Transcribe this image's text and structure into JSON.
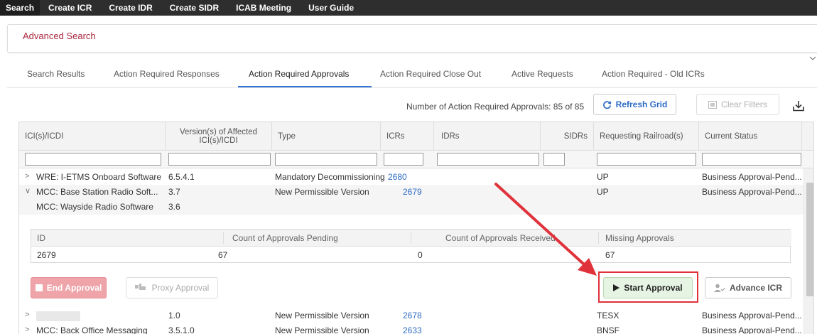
{
  "topnav": {
    "items": [
      "Search",
      "Create ICR",
      "Create IDR",
      "Create SIDR",
      "ICAB Meeting",
      "User Guide"
    ]
  },
  "advanced_search": {
    "title": "Advanced Search"
  },
  "tabs": [
    "Search Results",
    "Action Required Responses",
    "Action Required Approvals",
    "Action Required Close Out",
    "Active Requests",
    "Action Required - Old ICRs"
  ],
  "active_tab": "Action Required Approvals",
  "toolbar": {
    "count_text": "Number of Action Required Approvals: 85 of 85",
    "refresh_label": "Refresh Grid",
    "clear_label": "Clear Filters"
  },
  "grid": {
    "headers": [
      "ICI(s)/ICDI",
      "Version(s) of Affected ICI(s)/ICDI",
      "Type",
      "ICRs",
      "IDRs",
      "SIDRs",
      "Requesting Railroad(s)",
      "Current Status"
    ],
    "rows": [
      {
        "ici": "WRE: I-ETMS Onboard Software",
        "version": "6.5.4.1",
        "type": "Mandatory Decommissioning",
        "icr": "2680",
        "railroad": "UP",
        "status": "Business Approval-Pend..."
      },
      {
        "ici": "MCC: Base Station Radio Soft...",
        "version": "3.7",
        "type": "New Permissible Version",
        "icr": "2679",
        "railroad": "UP",
        "status": "Business Approval-Pend..."
      },
      {
        "ici": "MCC: Wayside Radio Software",
        "version": "3.6"
      },
      {
        "ici": "",
        "version": "1.0",
        "type": "New Permissible Version",
        "icr": "2678",
        "railroad": "TESX",
        "status": "Business Approval-Pend..."
      },
      {
        "ici": "MCC: Back Office Messaging",
        "version": "3.5.1.0",
        "type": "New Permissible Version",
        "icr": "2633",
        "railroad": "BNSF",
        "status": "Business Approval-Pend..."
      }
    ]
  },
  "detail": {
    "headers": [
      "ID",
      "Count of Approvals Pending",
      "Count of Approvals Received",
      "Missing Approvals"
    ],
    "values": [
      "2679",
      "67",
      "0",
      "67"
    ],
    "end_label": "End Approval",
    "proxy_label": "Proxy Approval",
    "start_label": "Start Approval",
    "advance_label": "Advance ICR"
  }
}
